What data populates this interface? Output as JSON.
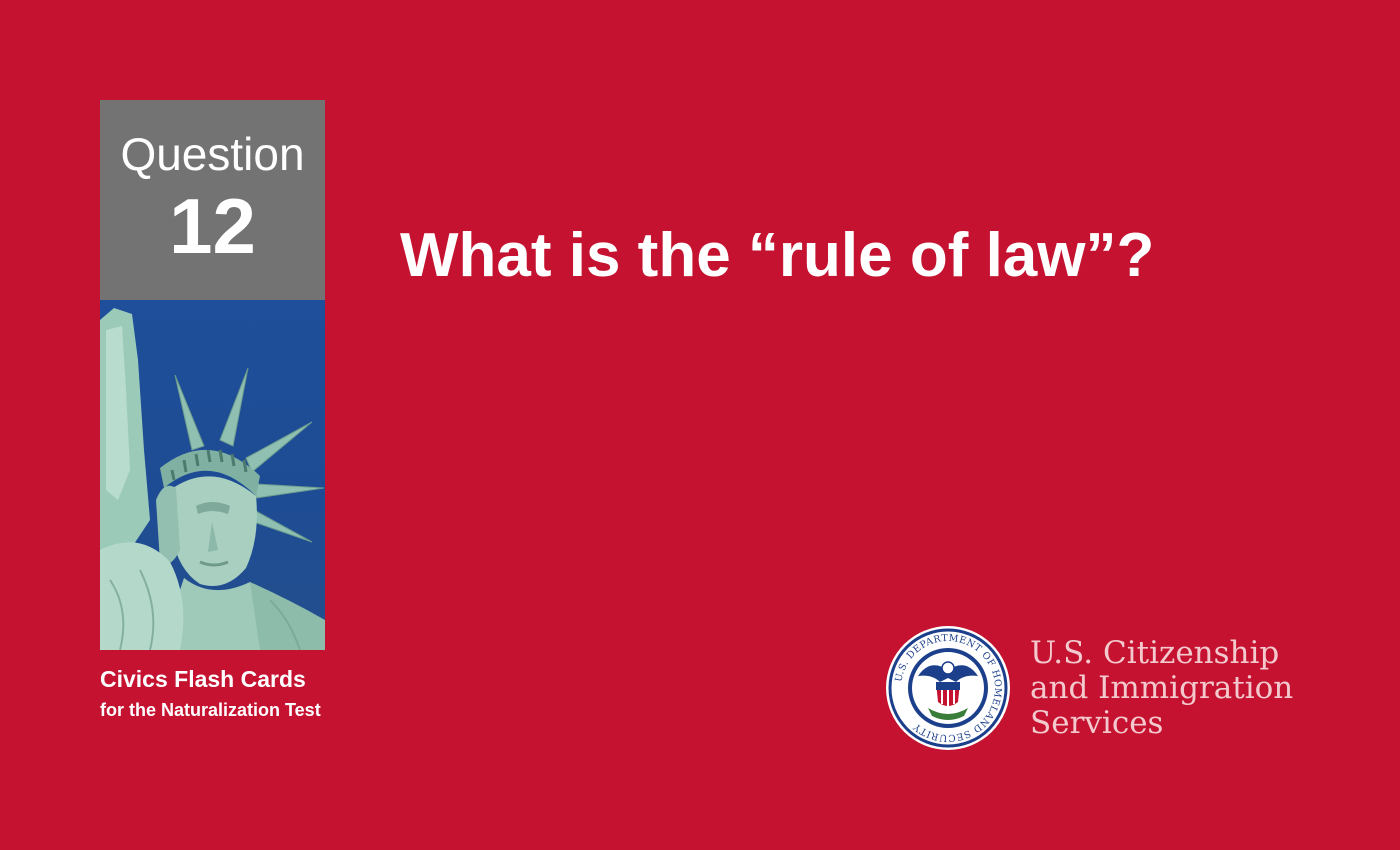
{
  "card": {
    "question_label": "Question",
    "question_number": "12",
    "question_text": "What is the “rule of law”?",
    "footer_title": "Civics Flash Cards",
    "footer_subtitle": "for the Naturalization Test"
  },
  "agency": {
    "line1": "U.S. Citizenship",
    "line2": "and Immigration",
    "line3": "Services",
    "seal_text": "U.S. DEPARTMENT OF HOMELAND SECURITY"
  },
  "colors": {
    "background": "#c41230",
    "question_box": "#737373",
    "sky": "#1f4f9a",
    "statue": "#a8cfc0",
    "agency_text": "#f3c9ce"
  },
  "icons": {
    "photo": "statue-of-liberty-photo",
    "seal": "dhs-seal-icon"
  }
}
